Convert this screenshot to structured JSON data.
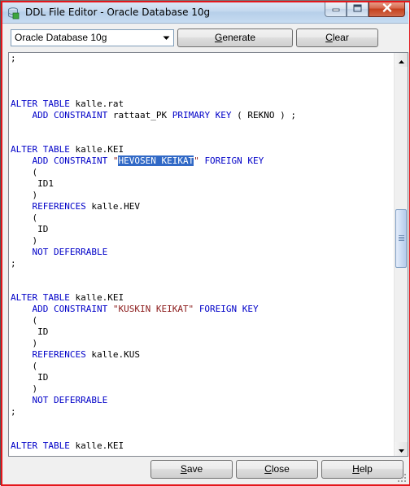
{
  "window": {
    "title": "DDL File Editor - Oracle Database 10g"
  },
  "toolbar": {
    "database_select": {
      "selected": "Oracle Database 10g",
      "icon": "chevron-down-icon"
    },
    "generate_label": "Generate",
    "clear_label": "Clear"
  },
  "editor": {
    "lines": [
      [
        {
          "t": ";",
          "c": ""
        }
      ],
      [],
      [],
      [],
      [
        {
          "t": "ALTER TABLE",
          "c": "kw"
        },
        {
          "t": " kalle.rat",
          "c": ""
        }
      ],
      [
        {
          "t": "    ",
          "c": ""
        },
        {
          "t": "ADD CONSTRAINT",
          "c": "kw"
        },
        {
          "t": " rattaat_PK ",
          "c": ""
        },
        {
          "t": "PRIMARY KEY",
          "c": "kw"
        },
        {
          "t": " ( REKNO ) ;",
          "c": ""
        }
      ],
      [],
      [],
      [
        {
          "t": "ALTER TABLE",
          "c": "kw"
        },
        {
          "t": " kalle.KEI",
          "c": ""
        }
      ],
      [
        {
          "t": "    ",
          "c": ""
        },
        {
          "t": "ADD CONSTRAINT",
          "c": "kw"
        },
        {
          "t": " ",
          "c": ""
        },
        {
          "t": "\"",
          "c": "str"
        },
        {
          "t": "HEVOSEN KEIKAT",
          "c": "sel"
        },
        {
          "t": "\"",
          "c": "str"
        },
        {
          "t": " ",
          "c": ""
        },
        {
          "t": "FOREIGN KEY",
          "c": "kw"
        }
      ],
      [
        {
          "t": "    (",
          "c": ""
        }
      ],
      [
        {
          "t": "     ID1",
          "c": ""
        }
      ],
      [
        {
          "t": "    )",
          "c": ""
        }
      ],
      [
        {
          "t": "    ",
          "c": ""
        },
        {
          "t": "REFERENCES",
          "c": "kw"
        },
        {
          "t": " kalle.HEV",
          "c": ""
        }
      ],
      [
        {
          "t": "    (",
          "c": ""
        }
      ],
      [
        {
          "t": "     ID",
          "c": ""
        }
      ],
      [
        {
          "t": "    )",
          "c": ""
        }
      ],
      [
        {
          "t": "    ",
          "c": ""
        },
        {
          "t": "NOT DEFERRABLE",
          "c": "kw"
        }
      ],
      [
        {
          "t": ";",
          "c": ""
        }
      ],
      [],
      [],
      [
        {
          "t": "ALTER TABLE",
          "c": "kw"
        },
        {
          "t": " kalle.KEI",
          "c": ""
        }
      ],
      [
        {
          "t": "    ",
          "c": ""
        },
        {
          "t": "ADD CONSTRAINT",
          "c": "kw"
        },
        {
          "t": " ",
          "c": ""
        },
        {
          "t": "\"KUSKIN KEIKAT\"",
          "c": "str"
        },
        {
          "t": " ",
          "c": ""
        },
        {
          "t": "FOREIGN KEY",
          "c": "kw"
        }
      ],
      [
        {
          "t": "    (",
          "c": ""
        }
      ],
      [
        {
          "t": "     ID",
          "c": ""
        }
      ],
      [
        {
          "t": "    )",
          "c": ""
        }
      ],
      [
        {
          "t": "    ",
          "c": ""
        },
        {
          "t": "REFERENCES",
          "c": "kw"
        },
        {
          "t": " kalle.KUS",
          "c": ""
        }
      ],
      [
        {
          "t": "    (",
          "c": ""
        }
      ],
      [
        {
          "t": "     ID",
          "c": ""
        }
      ],
      [
        {
          "t": "    )",
          "c": ""
        }
      ],
      [
        {
          "t": "    ",
          "c": ""
        },
        {
          "t": "NOT DEFERRABLE",
          "c": "kw"
        }
      ],
      [
        {
          "t": ";",
          "c": ""
        }
      ],
      [],
      [],
      [
        {
          "t": "ALTER TABLE",
          "c": "kw"
        },
        {
          "t": " kalle.KEI",
          "c": ""
        }
      ]
    ],
    "scroll_position_fraction": 0.45
  },
  "footer": {
    "save_label": "Save",
    "close_label": "Close",
    "help_label": "Help"
  },
  "colors": {
    "keyword": "#0000c8",
    "string": "#8b1a1a",
    "selection": "#3169c6",
    "frame_highlight": "#e4161b"
  }
}
